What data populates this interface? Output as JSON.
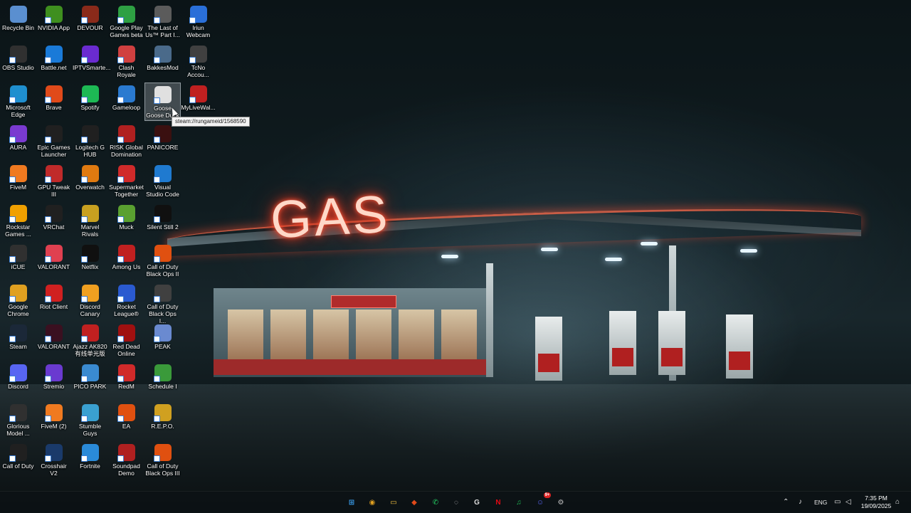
{
  "wallpaper": {
    "sign_text": "GAS"
  },
  "desktop": {
    "icons": [
      {
        "label": "Recycle Bin",
        "icon": "recycle-bin-icon",
        "color": "#5a8fd0"
      },
      {
        "label": "NVIDIA App",
        "icon": "nvidia-icon",
        "color": "#3f8f1f"
      },
      {
        "label": "DEVOUR",
        "icon": "devour-icon",
        "color": "#8a2a1a"
      },
      {
        "label": "Google Play Games beta",
        "icon": "google-play-games-icon",
        "color": "#2ea043"
      },
      {
        "label": "The Last of Us™ Part I...",
        "icon": "the-last-of-us-icon",
        "color": "#5b5b5b"
      },
      {
        "label": "Iriun Webcam",
        "icon": "webcam-icon",
        "color": "#2a6fd8"
      },
      {
        "label": "OBS Studio",
        "icon": "obs-icon",
        "color": "#303030"
      },
      {
        "label": "Battle.net",
        "icon": "battlenet-icon",
        "color": "#1a7ad8"
      },
      {
        "label": "IPTVSmarte...",
        "icon": "iptv-icon",
        "color": "#6a2bd0"
      },
      {
        "label": "Clash Royale",
        "icon": "clash-royale-icon",
        "color": "#d04040"
      },
      {
        "label": "BakkesMod",
        "icon": "bakkesmod-icon",
        "color": "#4a6a8a"
      },
      {
        "label": "TcNo Accou...",
        "icon": "tcno-icon",
        "color": "#404040"
      },
      {
        "label": "Microsoft Edge",
        "icon": "edge-icon",
        "color": "#1f8fcf"
      },
      {
        "label": "Brave",
        "icon": "brave-icon",
        "color": "#e04a1a"
      },
      {
        "label": "Spotify",
        "icon": "spotify-icon",
        "color": "#1db954"
      },
      {
        "label": "Gameloop",
        "icon": "gameloop-icon",
        "color": "#2a7ad0"
      },
      {
        "label": "Goose Goose Duck",
        "icon": "goose-goose-duck-icon",
        "color": "#e0e0e0"
      },
      {
        "label": "MyLiveWal...",
        "icon": "mylivewallpaper-icon",
        "color": "#c02020"
      },
      {
        "label": "AURA",
        "icon": "aura-icon",
        "color": "#7a3ad0"
      },
      {
        "label": "Epic Games Launcher",
        "icon": "epic-games-icon",
        "color": "#202020"
      },
      {
        "label": "Logitech G HUB",
        "icon": "logitech-icon",
        "color": "#202020"
      },
      {
        "label": "RISK Global Domination",
        "icon": "risk-icon",
        "color": "#b02020"
      },
      {
        "label": "PANICORE",
        "icon": "panicore-icon",
        "color": "#3a1010"
      },
      {
        "label": "FiveM",
        "icon": "fivem-icon",
        "color": "#f07a20"
      },
      {
        "label": "GPU Tweak III",
        "icon": "gpu-tweak-icon",
        "color": "#c02a2a"
      },
      {
        "label": "Overwatch",
        "icon": "overwatch-icon",
        "color": "#e07a10"
      },
      {
        "label": "Supermarket Together",
        "icon": "supermarket-together-icon",
        "color": "#d02a2a"
      },
      {
        "label": "Visual Studio Code",
        "icon": "vscode-icon",
        "color": "#1f7ad0"
      },
      {
        "label": "Rockstar Games ...",
        "icon": "rockstar-icon",
        "color": "#f0a000"
      },
      {
        "label": "VRChat",
        "icon": "vrchat-icon",
        "color": "#202020"
      },
      {
        "label": "Marvel Rivals",
        "icon": "marvel-rivals-icon",
        "color": "#c8a020"
      },
      {
        "label": "Muck",
        "icon": "muck-icon",
        "color": "#5aa030"
      },
      {
        "label": "Silent Still 2",
        "icon": "silent-still-icon",
        "color": "#101010"
      },
      {
        "label": "iCUE",
        "icon": "icue-icon",
        "color": "#303030"
      },
      {
        "label": "VALORANT",
        "icon": "valorant-icon",
        "color": "#e04050"
      },
      {
        "label": "Netflix",
        "icon": "netflix-icon",
        "color": "#101010"
      },
      {
        "label": "Among Us",
        "icon": "among-us-icon",
        "color": "#c02020"
      },
      {
        "label": "Call of Duty Black Ops II",
        "icon": "call-of-duty-bo2-icon",
        "color": "#e05010"
      },
      {
        "label": "Google Chrome",
        "icon": "chrome-icon",
        "color": "#e0a020"
      },
      {
        "label": "Riot Client",
        "icon": "riot-client-icon",
        "color": "#d02020"
      },
      {
        "label": "Discord Canary",
        "icon": "discord-canary-icon",
        "color": "#f0a020"
      },
      {
        "label": "Rocket League®",
        "icon": "rocket-league-icon",
        "color": "#2a5ad0"
      },
      {
        "label": "Call of Duty Black Ops I...",
        "icon": "call-of-duty-bo-icon",
        "color": "#404040"
      },
      {
        "label": "Steam",
        "icon": "steam-icon",
        "color": "#1b2838"
      },
      {
        "label": "VALORANT",
        "icon": "valorant-icon",
        "color": "#3a1020"
      },
      {
        "label": "Ajazz AK820 有线单光版",
        "icon": "ajazz-icon",
        "color": "#c02020"
      },
      {
        "label": "Red Dead Online",
        "icon": "red-dead-online-icon",
        "color": "#a01010"
      },
      {
        "label": "PEAK",
        "icon": "peak-icon",
        "color": "#6a8ad0"
      },
      {
        "label": "Discord",
        "icon": "discord-icon",
        "color": "#5865f2"
      },
      {
        "label": "Stremio",
        "icon": "stremio-icon",
        "color": "#6a3ad0"
      },
      {
        "label": "PICO PARK",
        "icon": "pico-park-icon",
        "color": "#3a8ad0"
      },
      {
        "label": "RedM",
        "icon": "redm-icon",
        "color": "#d02a2a"
      },
      {
        "label": "Schedule I",
        "icon": "schedule-i-icon",
        "color": "#3a9a3a"
      },
      {
        "label": "Glorious Model ...",
        "icon": "glorious-icon",
        "color": "#303030"
      },
      {
        "label": "FiveM (2)",
        "icon": "fivem-icon",
        "color": "#f07a20"
      },
      {
        "label": "Stumble Guys",
        "icon": "stumble-guys-icon",
        "color": "#3aa0d0"
      },
      {
        "label": "EA",
        "icon": "ea-icon",
        "color": "#e05010"
      },
      {
        "label": "R.E.P.O.",
        "icon": "repo-icon",
        "color": "#d0a020"
      },
      {
        "label": "Call of Duty",
        "icon": "call-of-duty-icon",
        "color": "#202020"
      },
      {
        "label": "Crosshair V2",
        "icon": "crosshair-icon",
        "color": "#1a3a6a"
      },
      {
        "label": "Fortnite",
        "icon": "fortnite-icon",
        "color": "#2a8ad8"
      },
      {
        "label": "Soundpad Demo",
        "icon": "soundpad-icon",
        "color": "#b02020"
      },
      {
        "label": "Call of Duty Black Ops III",
        "icon": "call-of-duty-bo3-icon",
        "color": "#e05010"
      }
    ]
  },
  "tooltip": {
    "text": "steam://rungameid/1568590"
  },
  "taskbar": {
    "apps": [
      {
        "name": "start-button",
        "glyph": "⊞",
        "color": "#3aa0f0"
      },
      {
        "name": "chrome-taskbar-icon",
        "glyph": "◉",
        "color": "#e0a020"
      },
      {
        "name": "file-explorer-taskbar-icon",
        "glyph": "▭",
        "color": "#f0c040"
      },
      {
        "name": "brave-taskbar-icon",
        "glyph": "◆",
        "color": "#e04a1a"
      },
      {
        "name": "whatsapp-taskbar-icon",
        "glyph": "✆",
        "color": "#25d366"
      },
      {
        "name": "app-circle-taskbar-icon",
        "glyph": "◌",
        "color": "#cccccc"
      },
      {
        "name": "logitech-taskbar-icon",
        "glyph": "G",
        "color": "#dddddd"
      },
      {
        "name": "netflix-taskbar-icon",
        "glyph": "N",
        "color": "#e50914"
      },
      {
        "name": "spotify-taskbar-icon",
        "glyph": "♫",
        "color": "#1db954"
      },
      {
        "name": "discord-taskbar-icon",
        "glyph": "☺",
        "color": "#5865f2",
        "badge": "9+"
      },
      {
        "name": "steam-taskbar-icon",
        "glyph": "⚙",
        "color": "#c0c0c0"
      }
    ],
    "tray": {
      "language": "ENG",
      "time": "7:35 PM",
      "date": "19/09/2025"
    }
  }
}
